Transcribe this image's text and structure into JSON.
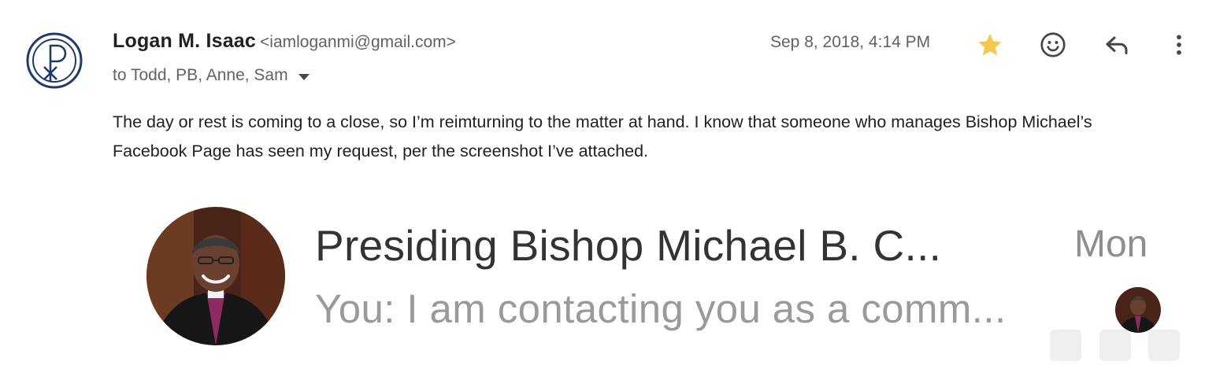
{
  "sender": {
    "name": "Logan M. Isaac",
    "email": "<iamloganmi@gmail.com>",
    "recipients": "to Todd, PB, Anne, Sam"
  },
  "header": {
    "date": "Sep 8, 2018, 4:14 PM",
    "icons": [
      "star-icon",
      "emoji-icon",
      "reply-icon",
      "more-vert-icon"
    ],
    "star_color": "#f4c84a"
  },
  "message": {
    "body": "The day or rest is coming to a close, so I’m reimturning to the matter at hand. I know that someone who manages Bishop Michael’s Facebook Page has seen my request, per the screenshot I’ve attached."
  },
  "attachment": {
    "contact_name": "Presiding Bishop Michael B. C...",
    "day": "Mon",
    "preview": "You: I am contacting you as a comm..."
  },
  "colors": {
    "logo_blue": "#1f3a6b",
    "secondary_text": "#5f6368"
  }
}
